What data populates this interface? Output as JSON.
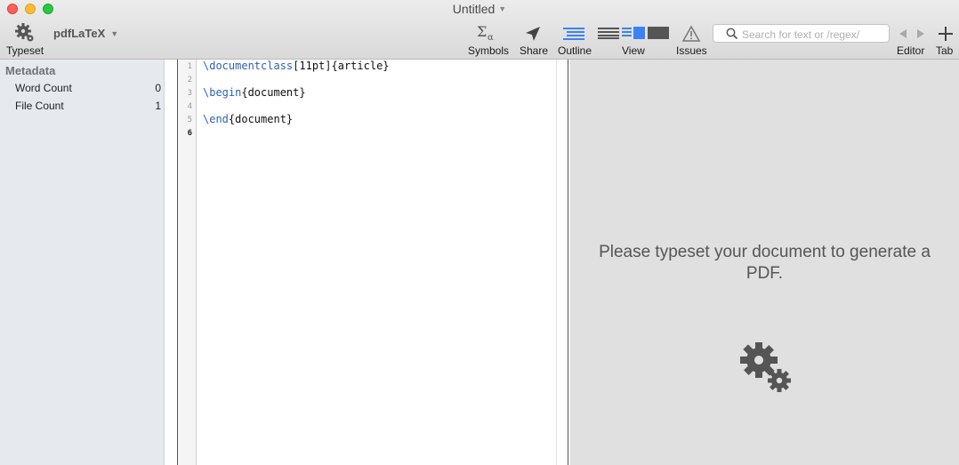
{
  "window": {
    "title": "Untitled"
  },
  "toolbar": {
    "typeset_label": "Typeset",
    "engine_label": "pdfLaTeX",
    "symbols_label": "Symbols",
    "share_label": "Share",
    "outline_label": "Outline",
    "view_label": "View",
    "issues_label": "Issues",
    "search_placeholder": "Search for text or /regex/",
    "editor_label": "Editor",
    "tab_label": "Tab"
  },
  "sidebar": {
    "heading": "Metadata",
    "items": [
      {
        "label": "Word Count",
        "value": "0"
      },
      {
        "label": "File Count",
        "value": "1"
      }
    ]
  },
  "editor": {
    "line_numbers": [
      "1",
      "2",
      "3",
      "4",
      "5",
      "6"
    ],
    "lines": [
      {
        "cmd": "\\documentclass",
        "rest": "[11pt]{article}"
      },
      {
        "cmd": "",
        "rest": ""
      },
      {
        "cmd": "\\begin",
        "rest": "{document}"
      },
      {
        "cmd": "",
        "rest": ""
      },
      {
        "cmd": "\\end",
        "rest": "{document}"
      },
      {
        "cmd": "",
        "rest": ""
      }
    ]
  },
  "preview": {
    "message": "Please typeset your document to generate a PDF."
  },
  "colors": {
    "keyword": "#2c64b4",
    "accent": "#3b82f6"
  }
}
